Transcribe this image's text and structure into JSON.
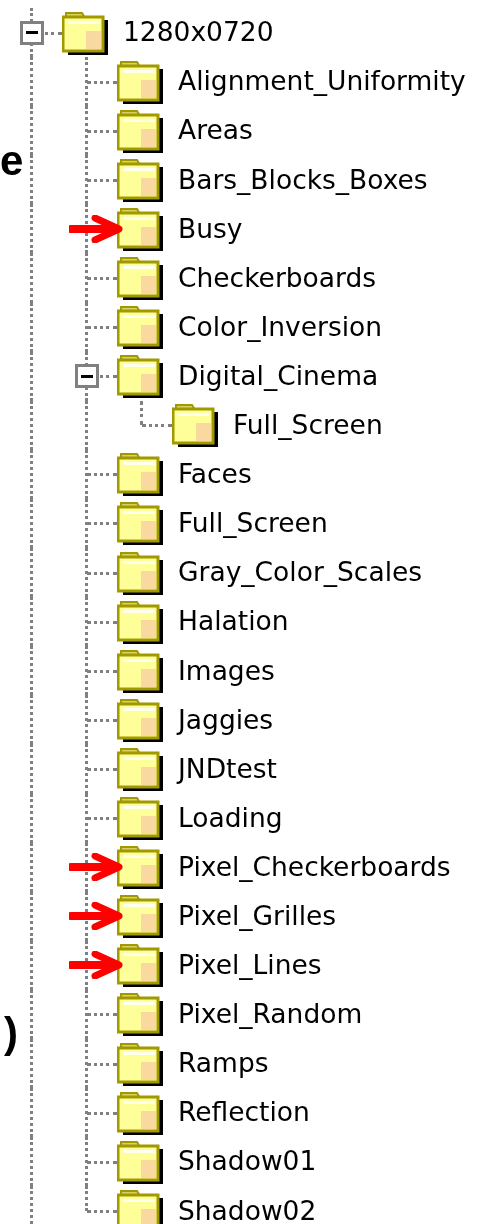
{
  "side_text": [
    {
      "text": "e"
    },
    {
      "text": ")"
    }
  ],
  "tree": [
    {
      "label": "1280x0720",
      "expanded": true,
      "children": [
        {
          "label": "Alignment_Uniformity",
          "marked": false
        },
        {
          "label": "Areas",
          "marked": false
        },
        {
          "label": "Bars_Blocks_Boxes",
          "marked": false
        },
        {
          "label": "Busy",
          "marked": true
        },
        {
          "label": "Checkerboards",
          "marked": false
        },
        {
          "label": "Color_Inversion",
          "marked": false
        },
        {
          "label": "Digital_Cinema",
          "marked": false,
          "expanded": true,
          "children": [
            {
              "label": "Full_Screen",
              "marked": false
            }
          ]
        },
        {
          "label": "Faces",
          "marked": false
        },
        {
          "label": "Full_Screen",
          "marked": false
        },
        {
          "label": "Gray_Color_Scales",
          "marked": false
        },
        {
          "label": "Halation",
          "marked": false
        },
        {
          "label": "Images",
          "marked": false
        },
        {
          "label": "Jaggies",
          "marked": false
        },
        {
          "label": "JNDtest",
          "marked": false
        },
        {
          "label": "Loading",
          "marked": false
        },
        {
          "label": "Pixel_Checkerboards",
          "marked": true
        },
        {
          "label": "Pixel_Grilles",
          "marked": true
        },
        {
          "label": "Pixel_Lines",
          "marked": true
        },
        {
          "label": "Pixel_Random",
          "marked": false
        },
        {
          "label": "Ramps",
          "marked": false
        },
        {
          "label": "Reflection",
          "marked": false
        },
        {
          "label": "Shadow01",
          "marked": false
        },
        {
          "label": "Shadow02",
          "marked": false
        }
      ]
    }
  ]
}
